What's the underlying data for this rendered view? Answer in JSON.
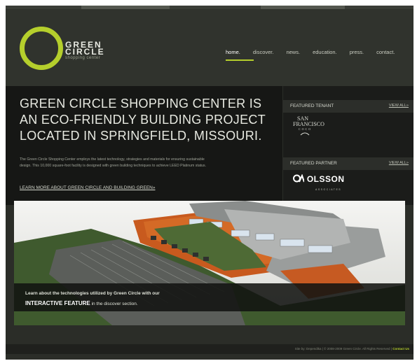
{
  "colors": {
    "accent": "#b5cf2c",
    "background": "#2b2d28",
    "band": "#161715"
  },
  "logo": {
    "line1": "GREEN",
    "line2": "CIRCLE",
    "sub": "shopping center"
  },
  "nav": [
    {
      "label": "home."
    },
    {
      "label": "discover."
    },
    {
      "label": "news."
    },
    {
      "label": "education."
    },
    {
      "label": "press."
    },
    {
      "label": "contact."
    }
  ],
  "hero": {
    "title_line1": "GREEN CIRCLE SHOPPING CENTER IS",
    "title_line2": "AN ECO-FRIENDLY BUILDING PROJECT",
    "title_line3": "LOCATED IN SPRINGFIELD, MISSOURI.",
    "body_line1": "The Green Circle Shopping Center employs the latest technology, strategies and materials for ensuring sustainable",
    "body_line2": "design. This 10,000 square-foot facility is designed with green building techniques to achieve LEED Platinum status.",
    "link": "LEARN MORE ABOUT GREEN CIRCLE AND BUILDING GREEN»"
  },
  "sidebar": {
    "tenant_heading": "FEATURED TENANT",
    "tenant_view_all": "VIEW ALL»",
    "tenant_logo_line1": "SAN",
    "tenant_logo_line2": "FRANCISCO",
    "tenant_logo_line3": "COCO",
    "partner_heading": "FEATURED PARTNER",
    "partner_view_all": "VIEW ALL»",
    "partner_logo": "OLSSON",
    "partner_logo_sub": "ASSOCIATES"
  },
  "feature": {
    "line1": "Learn about the technologies utilized by Green Circle with our",
    "highlight": "INTERACTIVE FEATURE",
    "line2_rest": "in the discover section."
  },
  "footer": {
    "site_by": "Site by: Dependika",
    "copyright": "© 2008-2009 Green Circle. All Rights Reserved",
    "contact": "Contact Us"
  }
}
